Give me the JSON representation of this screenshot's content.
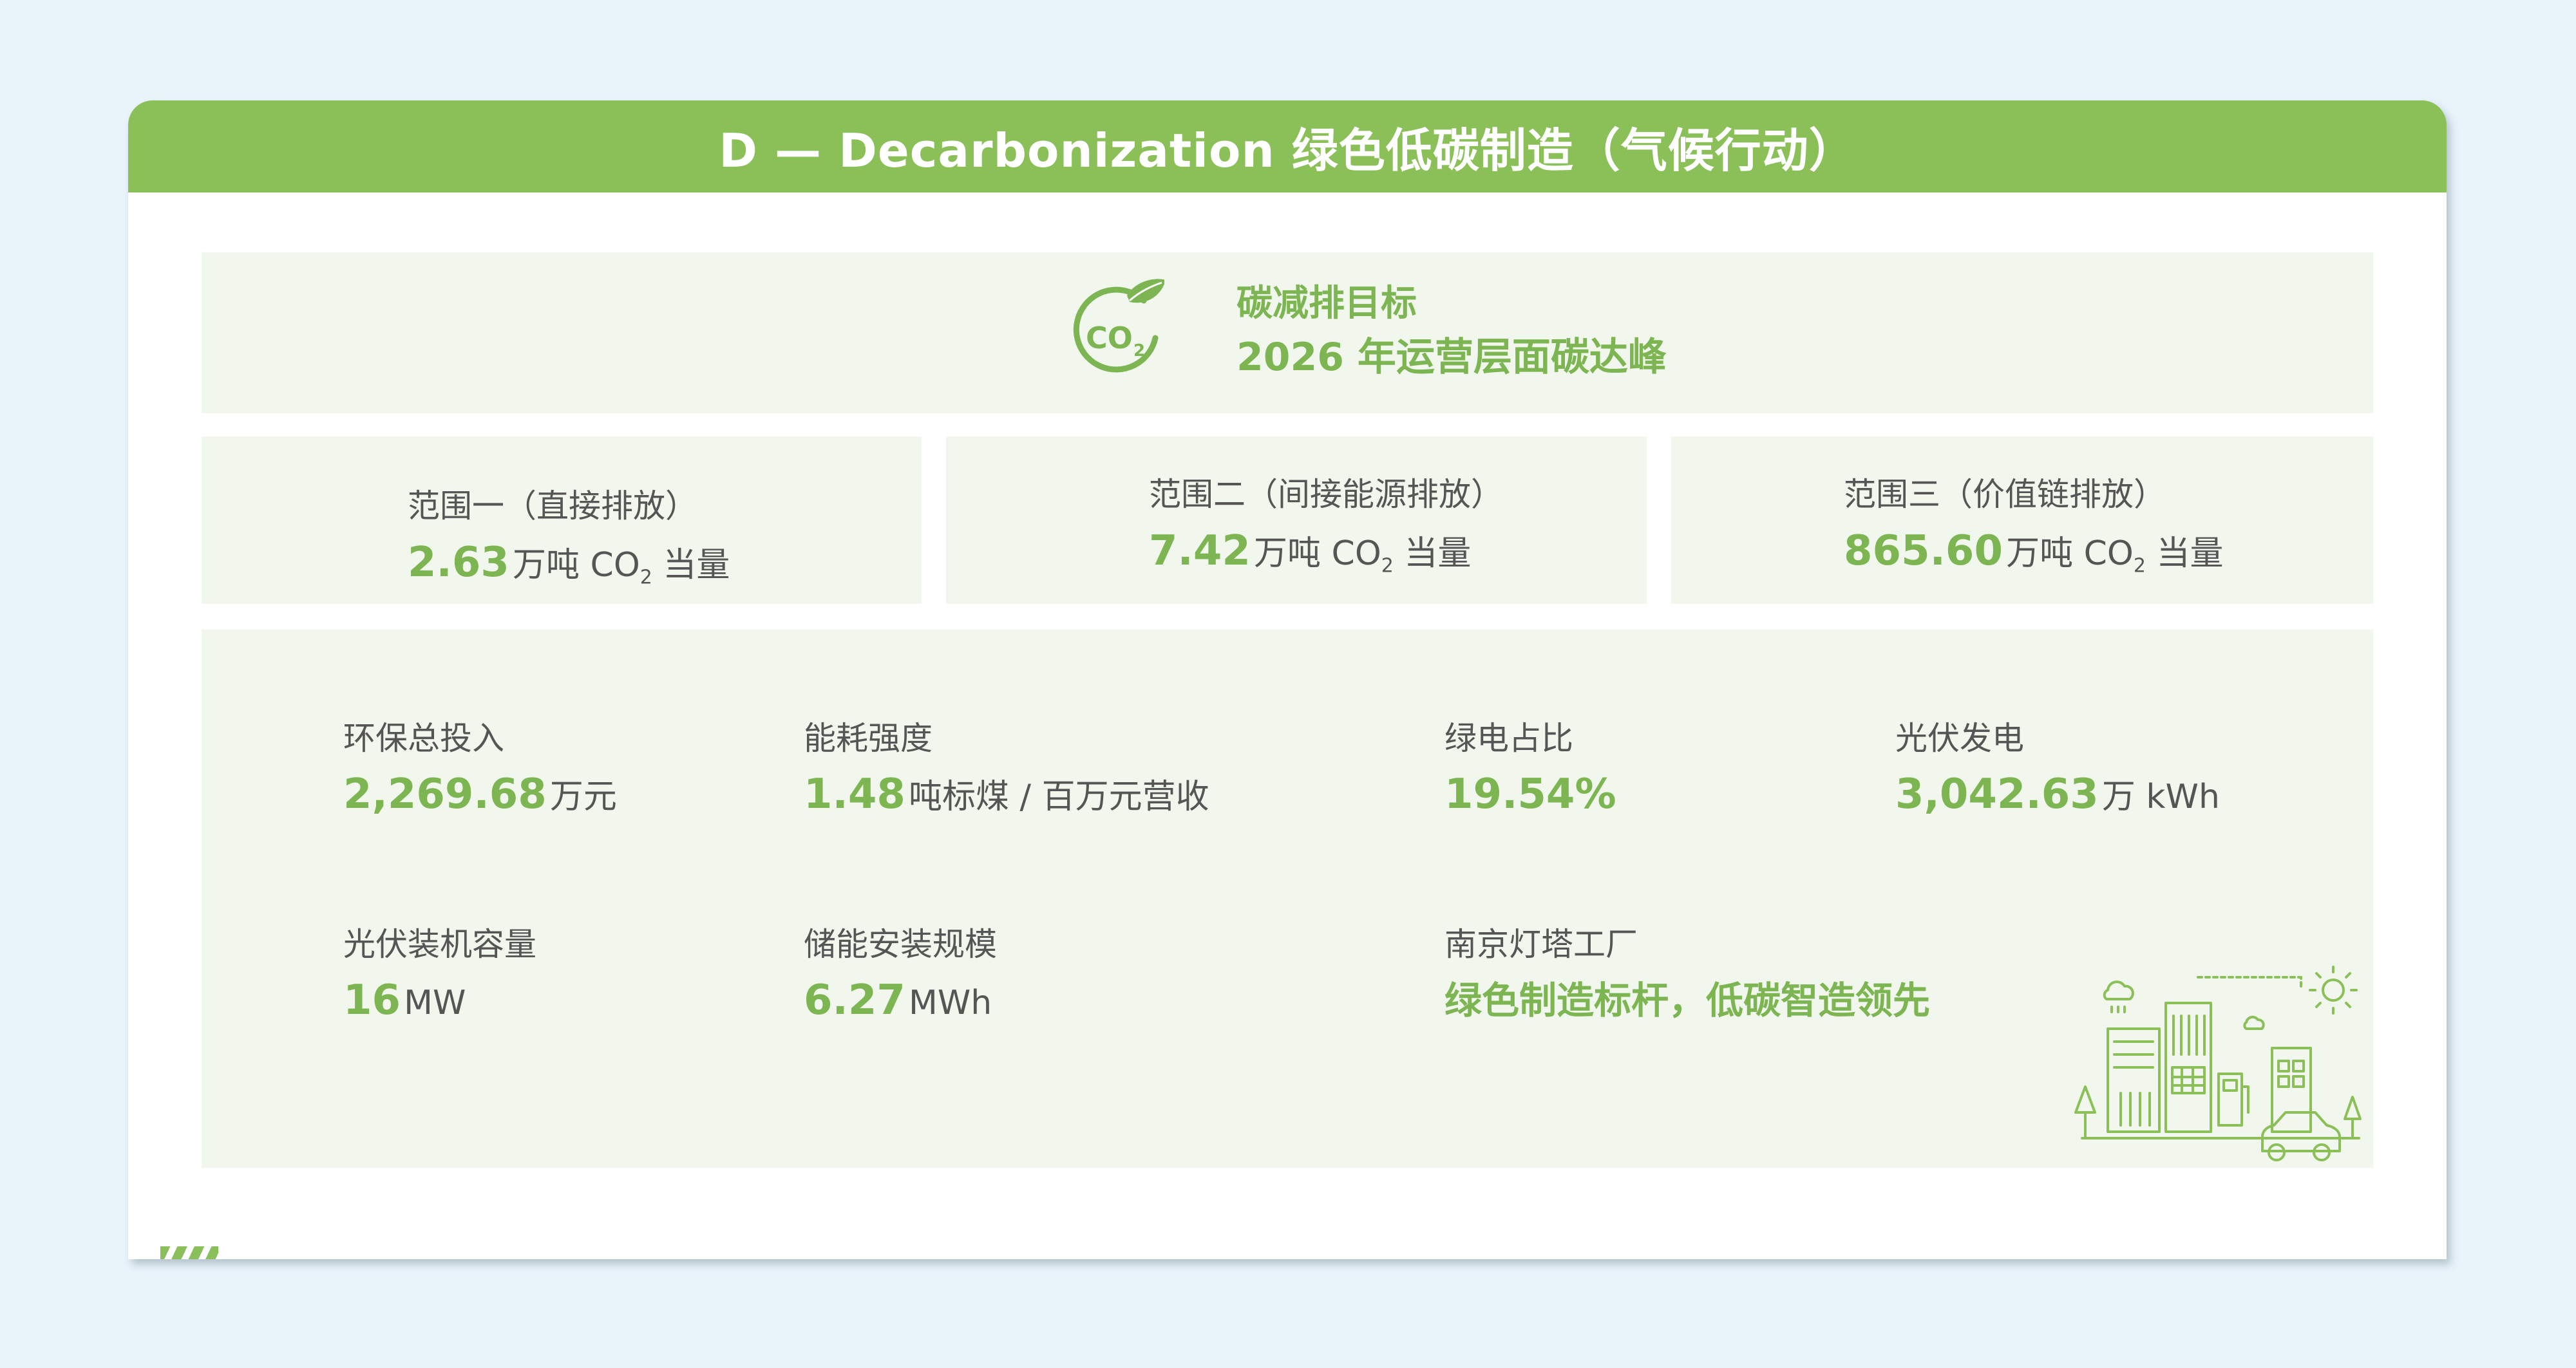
{
  "header": {
    "title": "D — Decarbonization 绿色低碳制造（气候行动）"
  },
  "goal": {
    "icon": "co2-leaf-icon",
    "icon_text": "CO",
    "icon_sub": "2",
    "label": "碳减排目标",
    "value": "2026 年运营层面碳达峰"
  },
  "scopes": [
    {
      "label": "范围一（直接排放）",
      "value": "2.63",
      "unit": "万吨 CO",
      "sub": "2",
      "suffix": " 当量"
    },
    {
      "label": "范围二（间接能源排放）",
      "value": "7.42",
      "unit": "万吨 CO",
      "sub": "2",
      "suffix": " 当量"
    },
    {
      "label": "范围三（价值链排放）",
      "value": "865.60",
      "unit": "万吨 CO",
      "sub": "2",
      "suffix": " 当量"
    }
  ],
  "metrics": [
    {
      "label": "环保总投入",
      "value": "2,269.68",
      "unit": "万元"
    },
    {
      "label": "能耗强度",
      "value": "1.48",
      "unit": "吨标煤 / 百万元营收"
    },
    {
      "label": "绿电占比",
      "value": "19.54%",
      "unit": ""
    },
    {
      "label": "光伏发电",
      "value": "3,042.63",
      "unit": "万 kWh"
    },
    {
      "label": "光伏装机容量",
      "value": "16",
      "unit": "MW"
    },
    {
      "label": "储能安装规模",
      "value": "6.27",
      "unit": "MWh"
    },
    {
      "label": "南京灯塔工厂",
      "value": "绿色制造标杆，低碳智造领先",
      "unit": ""
    }
  ],
  "colors": {
    "accent_green": "#8bbf58",
    "value_green": "#7cb552",
    "panel_bg": "#f1f7ec",
    "page_bg": "#e8f3fa"
  }
}
